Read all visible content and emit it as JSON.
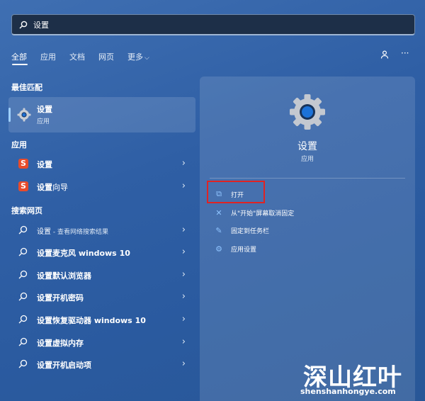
{
  "search": {
    "value": "设置",
    "icon": "search-icon"
  },
  "tabs": [
    {
      "label": "全部",
      "active": true
    },
    {
      "label": "应用"
    },
    {
      "label": "文档"
    },
    {
      "label": "网页"
    },
    {
      "label": "更多"
    }
  ],
  "sections": {
    "best_match": "最佳匹配",
    "apps": "应用",
    "web": "搜索网页"
  },
  "best_match": {
    "title": "设置",
    "subtitle": "应用"
  },
  "apps": [
    {
      "label": "设置"
    },
    {
      "label_bold": "设置",
      "label_rest": "向导"
    }
  ],
  "web_results": [
    {
      "bold": "设置",
      "rest": " - 查看网络搜索结果"
    },
    {
      "bold": "设置麦克风 windows 10",
      "rest": ""
    },
    {
      "bold": "设置默认浏览器",
      "rest": ""
    },
    {
      "bold": "设置开机密码",
      "rest": ""
    },
    {
      "bold": "设置恢复驱动器 windows 10",
      "rest": ""
    },
    {
      "bold": "设置虚拟内存",
      "rest": ""
    },
    {
      "bold": "设置开机启动项",
      "rest": ""
    }
  ],
  "pane": {
    "title": "设置",
    "subtitle": "应用",
    "actions": [
      {
        "label": "打开",
        "icon": "open-external-icon"
      },
      {
        "label": "从\"开始\"屏幕取消固定",
        "icon": "unpin-icon"
      },
      {
        "label": "固定到任务栏",
        "icon": "pin-icon"
      },
      {
        "label": "应用设置",
        "icon": "gear-icon"
      }
    ]
  },
  "watermark": {
    "logo": "深山红叶",
    "url": "shenshanhongye.com"
  },
  "colors": {
    "accent": "#9fd0ff",
    "highlight_box": "#e02323",
    "background": "#2f5fa5"
  }
}
